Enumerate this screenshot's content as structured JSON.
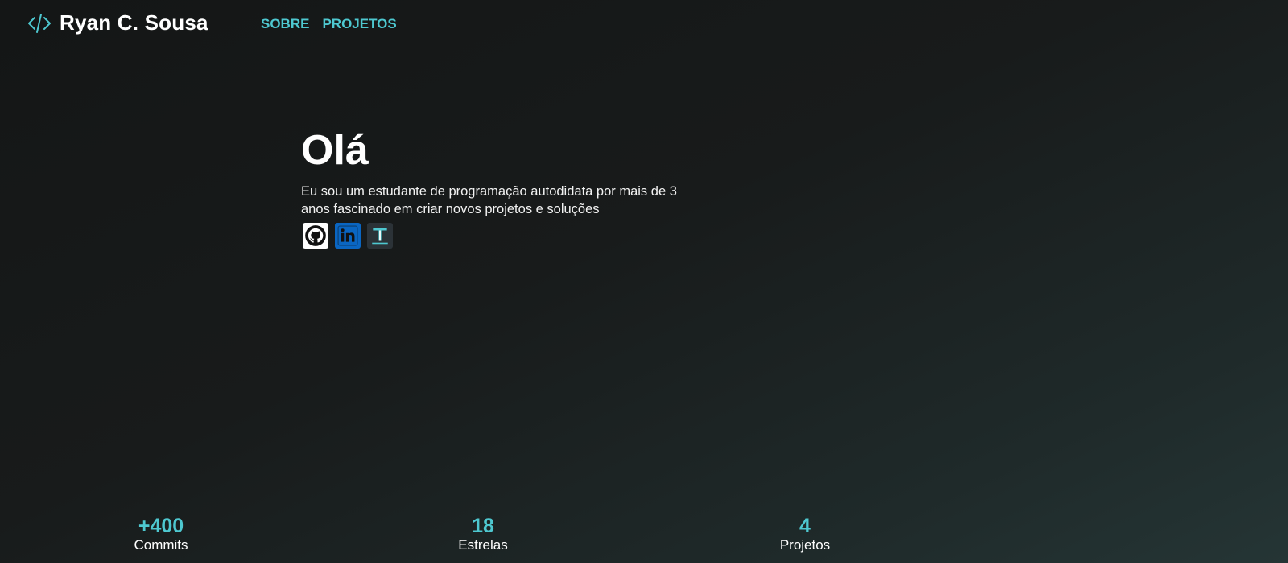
{
  "header": {
    "brand": "Ryan C. Sousa",
    "logo_icon": "code-brackets-icon",
    "nav": [
      {
        "label": "SOBRE"
      },
      {
        "label": "PROJETOS"
      }
    ]
  },
  "hero": {
    "title": "Olá",
    "text": "Eu sou um estudante de programação autodidata por mais de 3 anos fascinado em criar novos projetos e soluções",
    "socials": [
      {
        "icon": "github-icon"
      },
      {
        "icon": "linkedin-icon"
      },
      {
        "icon": "t-icon",
        "glyph": "T"
      }
    ]
  },
  "stats": [
    {
      "value": "+400",
      "label": "Commits"
    },
    {
      "value": "18",
      "label": "Estrelas"
    },
    {
      "value": "4",
      "label": "Projetos"
    }
  ],
  "colors": {
    "accent": "#4ec8d0",
    "linkedin": "#0a66c2",
    "background_start": "#141616",
    "background_end": "#253535"
  }
}
